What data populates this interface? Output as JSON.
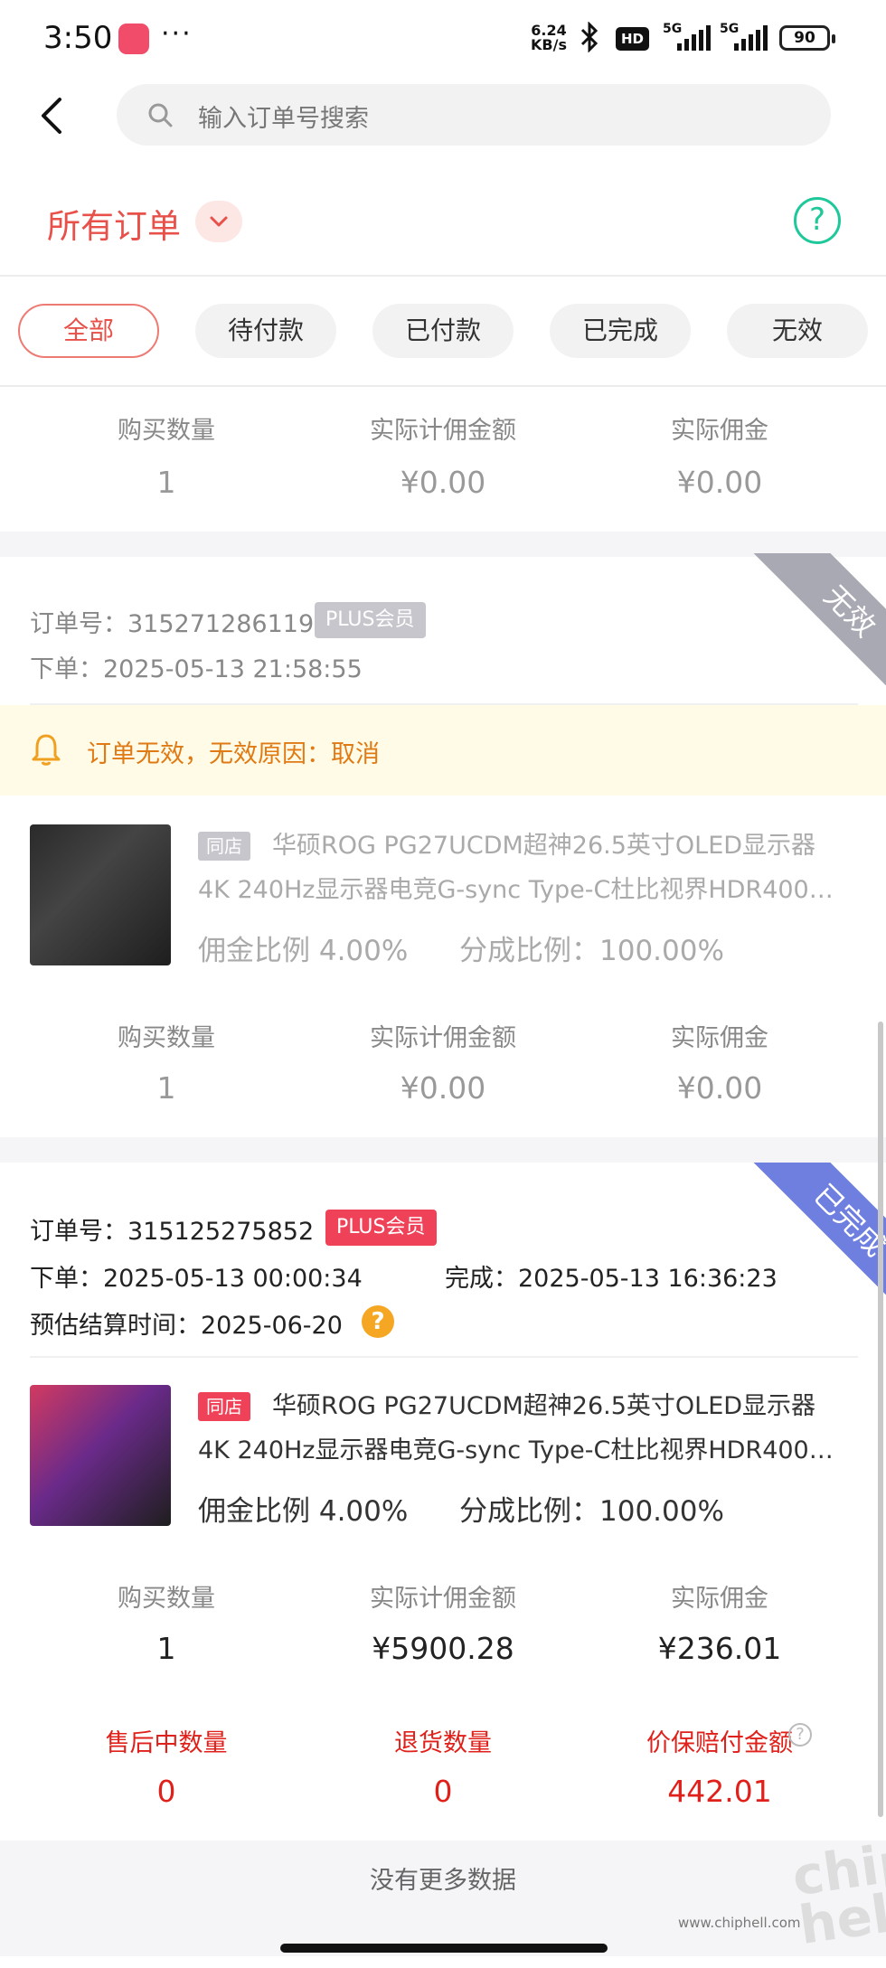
{
  "status_bar": {
    "time": "3:50",
    "dots": "···",
    "speed_value": "6.24",
    "speed_unit": "KB/s",
    "hd": "HD",
    "net1": "5G",
    "net2": "5G",
    "battery": "90"
  },
  "search": {
    "placeholder": "输入订单号搜索"
  },
  "header": {
    "title": "所有订单",
    "help": "?"
  },
  "tabs": [
    {
      "label": "全部",
      "active": true
    },
    {
      "label": "待付款"
    },
    {
      "label": "已付款"
    },
    {
      "label": "已完成"
    },
    {
      "label": "无效"
    }
  ],
  "stat_labels": {
    "qty": "购买数量",
    "amount": "实际计佣金额",
    "commission": "实际佣金"
  },
  "top_partial": {
    "qty": "1",
    "amount": "¥0.00",
    "commission": "¥0.00"
  },
  "order1": {
    "ribbon": "无效",
    "order_no": "订单号：315271286119",
    "plus": "PLUS会员",
    "placed": "下单：2025-05-13 21:58:55",
    "warning": "订单无效，无效原因：取消",
    "shop": "同店",
    "name_line1": "华硕ROG PG27UCDM超神26.5英寸OLED显示器",
    "name_line2": "4K 240Hz显示器电竞G-sync Type-C杜比视界HDR400…",
    "rate": "佣金比例 4.00%",
    "share": "分成比例：100.00%",
    "qty": "1",
    "amount": "¥0.00",
    "commission": "¥0.00"
  },
  "order2": {
    "ribbon": "已完成",
    "order_no": "订单号：315125275852",
    "plus": "PLUS会员",
    "placed": "下单：2025-05-13 00:00:34",
    "completed": "完成：2025-05-13 16:36:23",
    "settle": "预估结算时间：2025-06-20",
    "shop": "同店",
    "name_line1": "华硕ROG PG27UCDM超神26.5英寸OLED显示器",
    "name_line2": "4K 240Hz显示器电竞G-sync Type-C杜比视界HDR400…",
    "rate": "佣金比例 4.00%",
    "share": "分成比例：100.00%",
    "qty": "1",
    "amount": "¥5900.28",
    "commission": "¥236.01",
    "after_sale_label": "售后中数量",
    "return_label": "退货数量",
    "price_protect_label": "价保赔付金额",
    "after_sale": "0",
    "returned": "0",
    "price_protect": "442.01"
  },
  "footer": {
    "text": "没有更多数据"
  },
  "watermark": {
    "url": "www.chiphell.com",
    "logo": "chip hell"
  },
  "colors": {
    "accent": "#e8504a",
    "teal": "#1fc89b",
    "invalid_ribbon": "#a9a9b3",
    "done_ribbon": "#6e7fe0",
    "warn": "#e07a14"
  }
}
